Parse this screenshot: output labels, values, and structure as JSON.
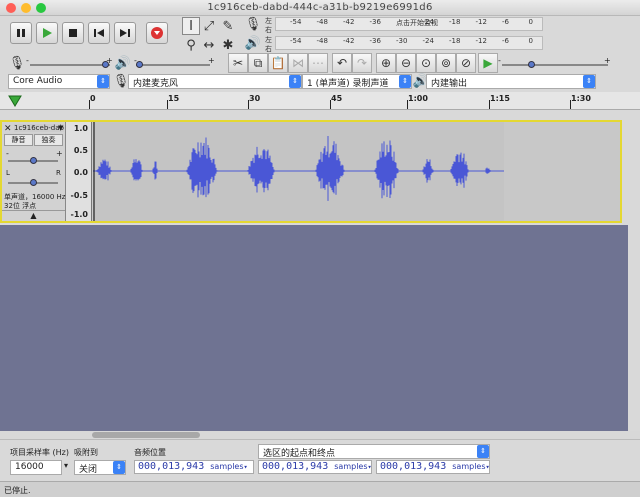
{
  "window": {
    "title": "1c916ceb-dabd-444c-a31b-b9219e6991d6"
  },
  "meters": {
    "record_scale": [
      "-54",
      "-48",
      "-42",
      "-36",
      "点击开始监视",
      "-24",
      "-18",
      "-12",
      "-6",
      "0"
    ],
    "play_scale": [
      "-54",
      "-48",
      "-42",
      "-36",
      "-30",
      "-24",
      "-18",
      "-12",
      "-6",
      "0"
    ],
    "left": "左",
    "right": "右"
  },
  "mixer": {
    "minus": "-",
    "plus": "+"
  },
  "devices": {
    "host": "Core Audio",
    "input_device": "内建麦克风",
    "channels": "1 (单声道) 录制声道",
    "output_device": "内建输出"
  },
  "ruler": {
    "ticks": [
      "0",
      "15",
      "30",
      "45",
      "1:00",
      "1:15",
      "1:30"
    ]
  },
  "track": {
    "name": "1c916ceb-dab",
    "mute": "静音",
    "solo": "独奏",
    "minus": "-",
    "plus": "+",
    "left": "L",
    "right": "R",
    "info_line1": "单声道，16000 Hz",
    "info_line2": "32位 浮点",
    "scale": [
      "1.0",
      "0.5",
      "0.0",
      "-0.5",
      "-1.0"
    ]
  },
  "bottom": {
    "rate_label": "项目采样率 (Hz)",
    "rate_value": "16000",
    "snap_label": "吸附到",
    "snap_value": "关闭",
    "position_label": "音频位置",
    "position_value": "000,013,943",
    "samples_unit": "samples",
    "selection_label": "选区的起点和终点",
    "sel_start": "000,013,943",
    "sel_end": "000,013,943"
  },
  "status": {
    "text": "已停止."
  },
  "colors": {
    "waveform": "#4a57d6",
    "track_bg": "#c4c4c4",
    "empty_bg": "#6f7392",
    "selection_border": "#e4d832"
  }
}
